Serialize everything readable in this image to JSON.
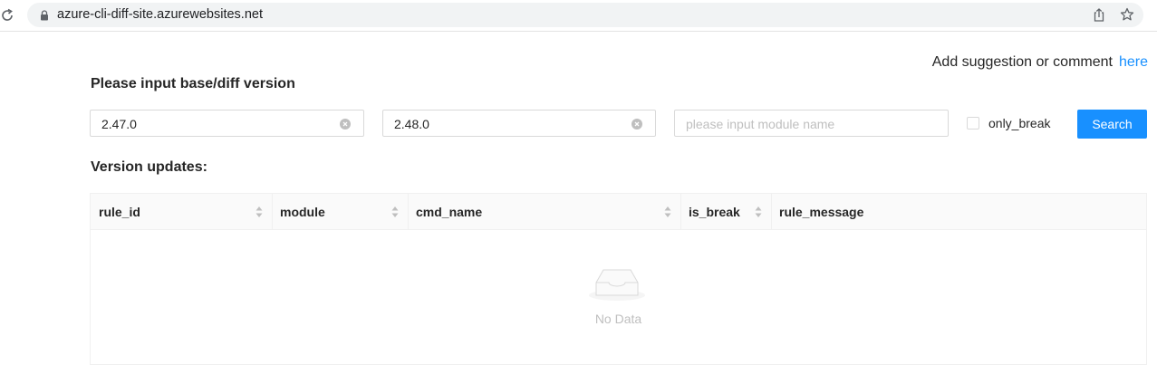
{
  "browser": {
    "url": "azure-cli-diff-site.azurewebsites.net"
  },
  "suggestion": {
    "text": "Add suggestion or comment",
    "link": "here"
  },
  "form": {
    "heading": "Please input base/diff version",
    "base_version": "2.47.0",
    "diff_version": "2.48.0",
    "module_placeholder": "please input module name",
    "only_break_label": "only_break",
    "search_label": "Search"
  },
  "results": {
    "heading": "Version updates:",
    "columns": [
      "rule_id",
      "module",
      "cmd_name",
      "is_break",
      "rule_message"
    ],
    "empty_text": "No Data"
  },
  "colors": {
    "primary": "#1890ff",
    "border": "#d9d9d9",
    "header_bg": "#fafafa"
  }
}
